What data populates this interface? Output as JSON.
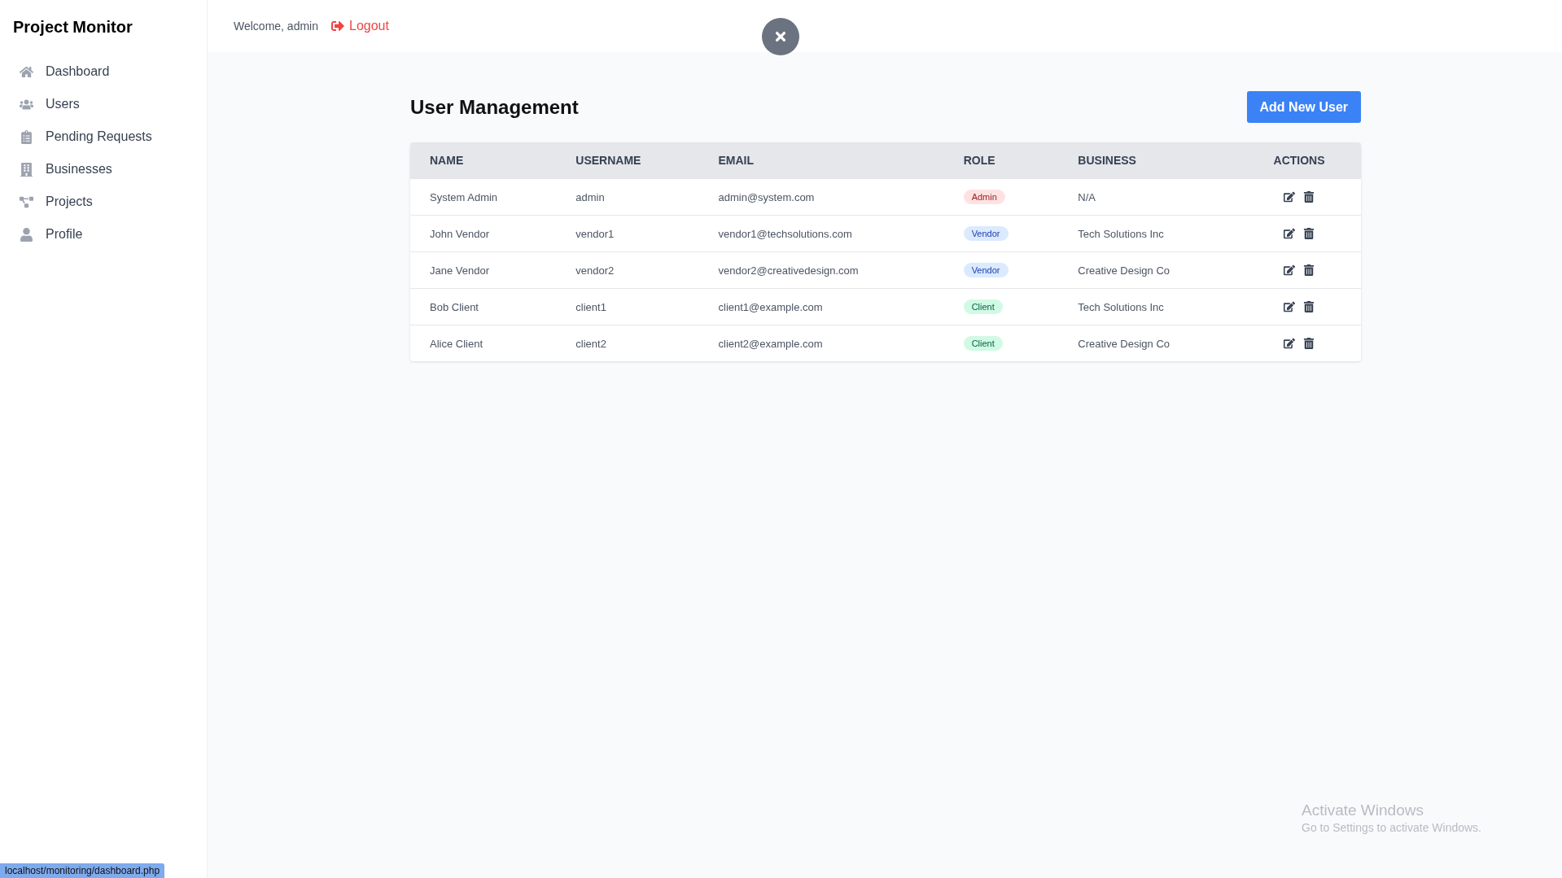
{
  "sidebar": {
    "title": "Project Monitor",
    "items": [
      {
        "label": "Dashboard"
      },
      {
        "label": "Users"
      },
      {
        "label": "Pending Requests"
      },
      {
        "label": "Businesses"
      },
      {
        "label": "Projects"
      },
      {
        "label": "Profile"
      }
    ]
  },
  "header": {
    "welcome": "Welcome, admin",
    "logout": "Logout"
  },
  "page": {
    "title": "User Management",
    "add_button": "Add New User"
  },
  "table": {
    "columns": [
      "NAME",
      "USERNAME",
      "EMAIL",
      "ROLE",
      "BUSINESS",
      "ACTIONS"
    ],
    "rows": [
      {
        "name": "System Admin",
        "username": "admin",
        "email": "admin@system.com",
        "role": {
          "label": "Admin",
          "kind": "admin"
        },
        "business": "N/A"
      },
      {
        "name": "John Vendor",
        "username": "vendor1",
        "email": "vendor1@techsolutions.com",
        "role": {
          "label": "Vendor",
          "kind": "vendor"
        },
        "business": "Tech Solutions Inc"
      },
      {
        "name": "Jane Vendor",
        "username": "vendor2",
        "email": "vendor2@creativedesign.com",
        "role": {
          "label": "Vendor",
          "kind": "vendor"
        },
        "business": "Creative Design Co"
      },
      {
        "name": "Bob Client",
        "username": "client1",
        "email": "client1@example.com",
        "role": {
          "label": "Client",
          "kind": "client"
        },
        "business": "Tech Solutions Inc"
      },
      {
        "name": "Alice Client",
        "username": "client2",
        "email": "client2@example.com",
        "role": {
          "label": "Client",
          "kind": "client"
        },
        "business": "Creative Design Co"
      }
    ]
  },
  "status_url": "localhost/monitoring/dashboard.php",
  "os_notice": {
    "title": "Activate Windows",
    "subtitle": "Go to Settings to activate Windows."
  }
}
